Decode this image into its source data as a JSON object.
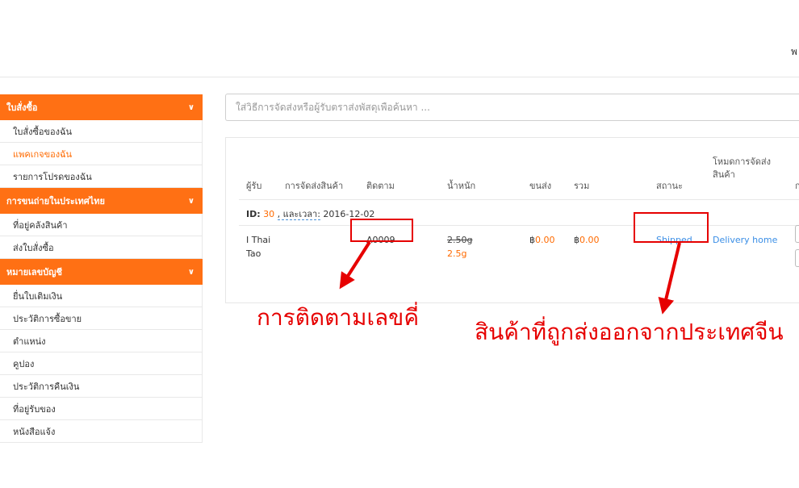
{
  "topbar": {
    "cut_text": "พ"
  },
  "sidebar": {
    "groups": [
      {
        "title": "ใบสั่งซื้อ",
        "items": [
          "ใบสั่งซื้อของฉัน",
          "แพคเกจของฉัน",
          "รายการโปรดของฉัน"
        ]
      },
      {
        "title": "การขนถ่ายในประเทศไทย",
        "items": [
          "ที่อยู่คลังสินค้า",
          "ส่งใบสั่งซื้อ"
        ]
      },
      {
        "title": "หมายเลขบัญชี",
        "items": [
          "ยื่นใบเติมเงิน",
          "ประวัติการซื้อขาย",
          "ตำแหน่ง",
          "คูปอง",
          "ประวัติการคืนเงิน",
          "ที่อยู่รับของ",
          "หนังสือแจ้ง"
        ]
      }
    ],
    "active_item": "แพคเกจของฉัน"
  },
  "search": {
    "placeholder": "ใส่วิธีการจัดส่งหรือผู้รับตราส่งพัสดุเพื่อค้นหา ..."
  },
  "table": {
    "headers": {
      "receiver": "ผู้รับ",
      "shipping": "การจัดส่งสินค้า",
      "tracking": "ติดตาม",
      "weight": "น้ำหนัก",
      "freight": "ขนส่ง",
      "total": "รวม",
      "status": "สถานะ",
      "mode_line1": "โหมดการจัดส่ง",
      "mode_line2": "สินค้า",
      "cut": "ก"
    },
    "order": {
      "id_label": "ID:",
      "id_value": "30",
      "date_label": ", และเวลา:",
      "date_value": "2016-12-02"
    },
    "row": {
      "receiver_line1": "I Thai",
      "receiver_line2": "Tao",
      "tracking": "A0009",
      "weight_old": "2.50g",
      "weight_new": "2.5g",
      "currency": "฿",
      "freight": "0.00",
      "total": "0.00",
      "status": "Shipped",
      "mode": "Delivery home"
    }
  },
  "annotations": {
    "tracking": "การติดตามเลขคี่",
    "shipped": "สินค้าที่ถูกส่งออกจากประเทศจีน"
  },
  "colors": {
    "accent": "#ff7014",
    "link": "#3a8ee6",
    "annotation": "#e60000"
  }
}
